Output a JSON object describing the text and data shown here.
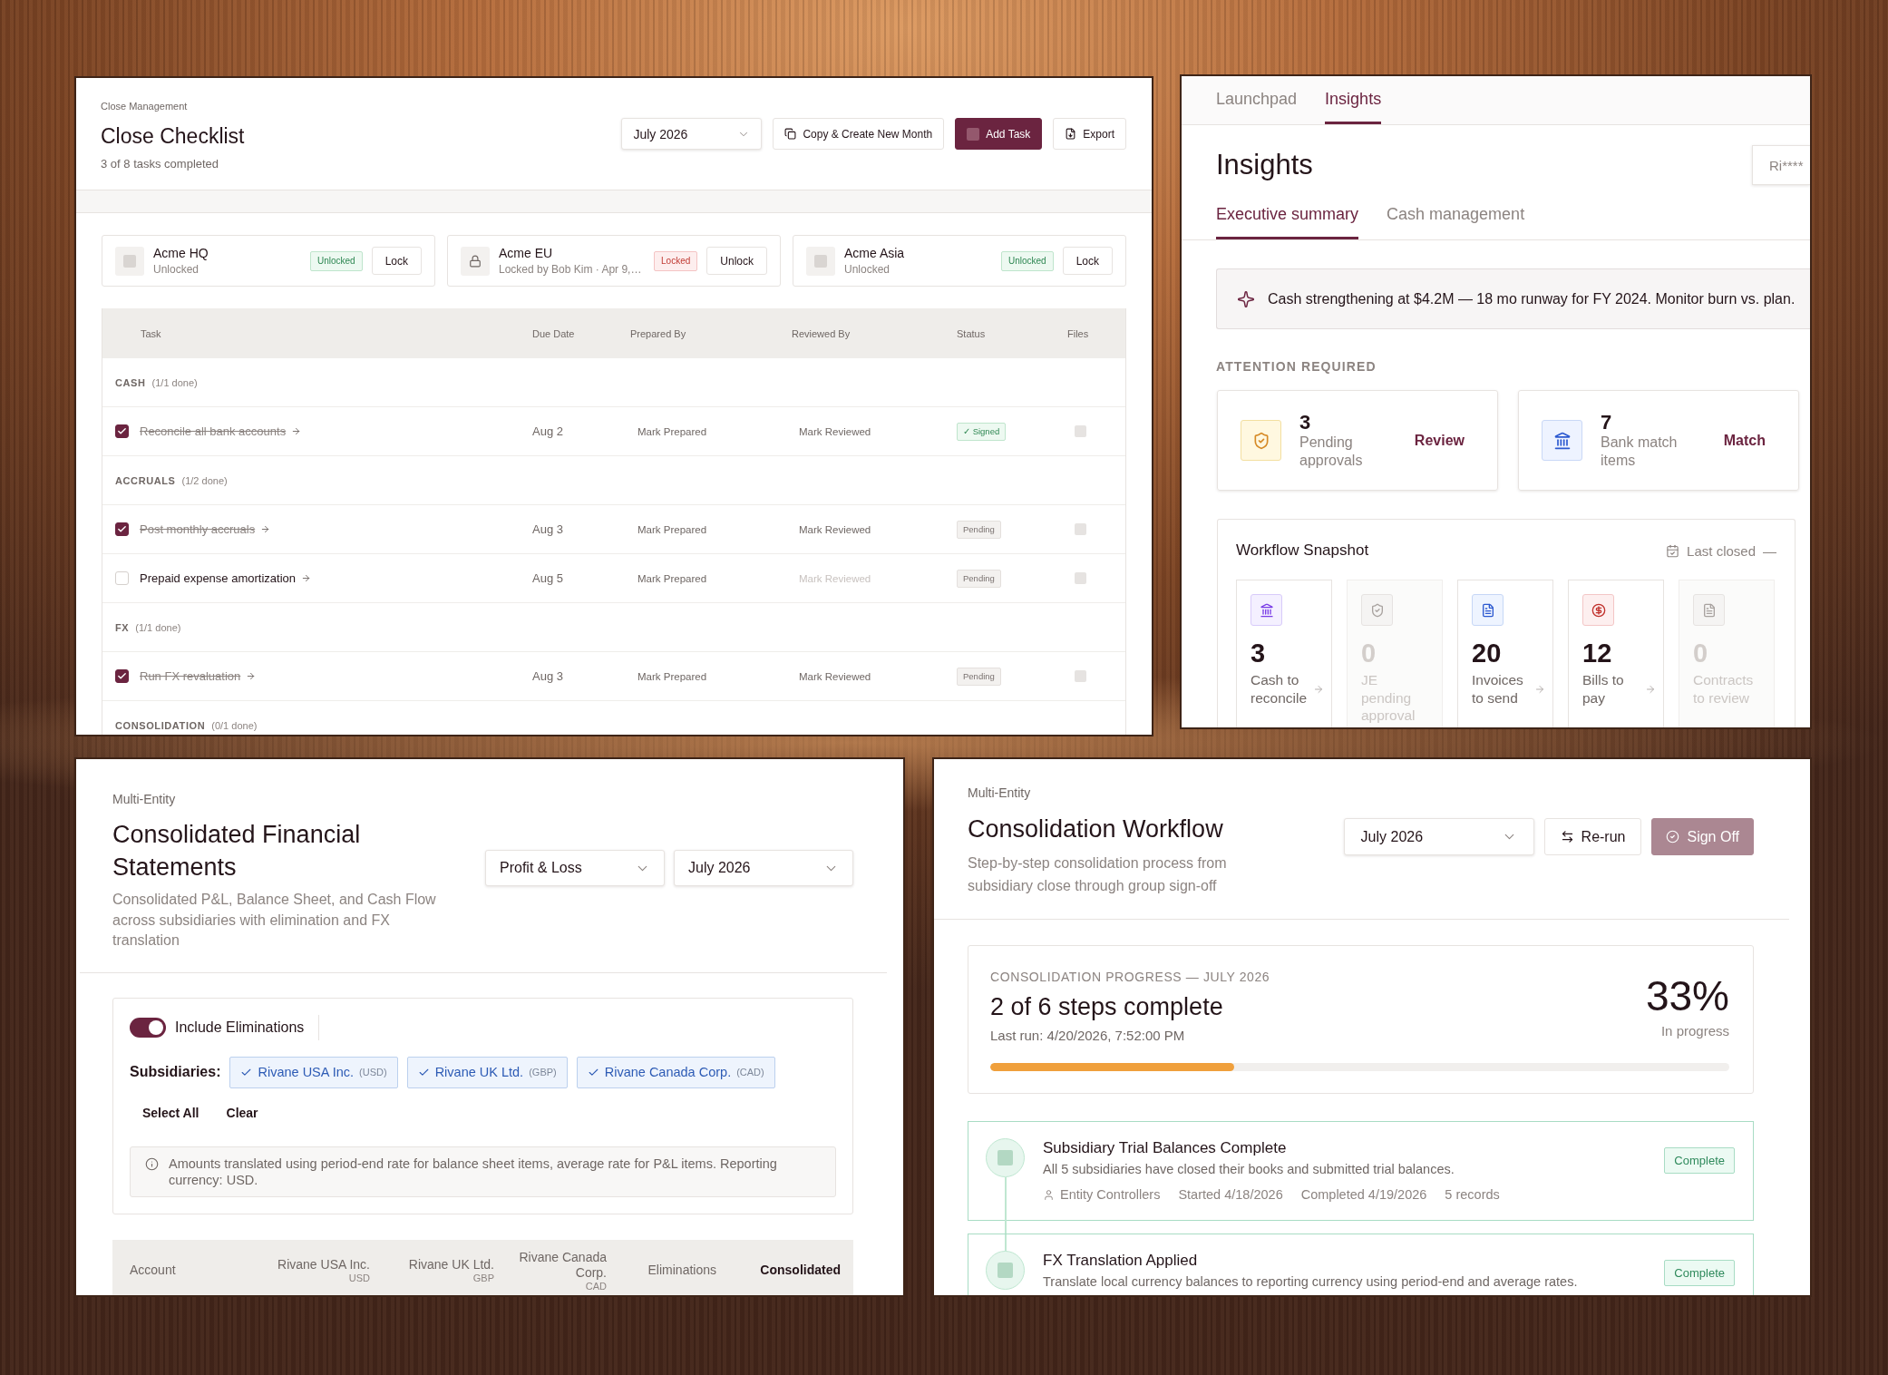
{
  "close_checklist": {
    "breadcrumb": "Close Management",
    "title": "Close Checklist",
    "subtitle": "3 of 8 tasks completed",
    "period": "July 2026",
    "actions": [
      {
        "kind": "copy",
        "label": "Copy & Create New Month"
      },
      {
        "kind": "add",
        "label": "Add Task"
      },
      {
        "kind": "export",
        "label": "Export"
      }
    ],
    "entities": [
      {
        "name": "Acme HQ",
        "detail": "Unlocked",
        "locked": false,
        "badge": "Unlocked",
        "action": "Lock"
      },
      {
        "name": "Acme EU",
        "detail": "Locked by Bob Kim · Apr 9,…",
        "locked": true,
        "badge": "Locked",
        "action": "Unlock"
      },
      {
        "name": "Acme Asia",
        "detail": "Unlocked",
        "locked": false,
        "badge": "Unlocked",
        "action": "Lock"
      }
    ],
    "table": {
      "columns": [
        "Task",
        "Due Date",
        "Prepared By",
        "Reviewed By",
        "Status",
        "Files"
      ],
      "groups": [
        {
          "name": "CASH",
          "count": "(1/1 done)",
          "tasks": [
            {
              "title": "Reconcile all bank accounts",
              "checked": true,
              "due": "Aug 2",
              "prepared_by": "Mark Prepared",
              "reviewed_by": "Mark Reviewed",
              "reviewed": true,
              "status": {
                "kind": "signed",
                "label": "✓ Signed"
              }
            }
          ]
        },
        {
          "name": "ACCRUALS",
          "count": "(1/2 done)",
          "tasks": [
            {
              "title": "Post monthly accruals",
              "checked": true,
              "due": "Aug 3",
              "prepared_by": "Mark Prepared",
              "reviewed_by": "Mark Reviewed",
              "reviewed": true,
              "status": {
                "kind": "pending",
                "label": "Pending"
              }
            },
            {
              "title": "Prepaid expense amortization",
              "checked": false,
              "due": "Aug 5",
              "prepared_by": "Mark Prepared",
              "reviewed_by": "Mark Reviewed",
              "reviewed": false,
              "status": {
                "kind": "pending",
                "label": "Pending"
              }
            }
          ]
        },
        {
          "name": "FX",
          "count": "(1/1 done)",
          "tasks": [
            {
              "title": "Run FX revaluation",
              "checked": true,
              "due": "Aug 3",
              "prepared_by": "Mark Prepared",
              "reviewed_by": "Mark Reviewed",
              "reviewed": true,
              "status": {
                "kind": "pending",
                "label": "Pending"
              }
            }
          ]
        },
        {
          "name": "CONSOLIDATION",
          "count": "(0/1 done)"
        }
      ]
    }
  },
  "insights": {
    "tabs": [
      {
        "label": "Launchpad",
        "selected": false
      },
      {
        "label": "Insights",
        "selected": true
      }
    ],
    "title": "Insights",
    "user": "Ri****",
    "sub_tabs": [
      {
        "label": "Executive summary",
        "selected": true
      },
      {
        "label": "Cash management",
        "selected": false
      }
    ],
    "insight": "Cash strengthening at $4.2M — 18 mo runway for FY 2024. Monitor burn vs. plan.",
    "attention": {
      "heading": "ATTENTION REQUIRED",
      "items": [
        {
          "kind": "approvals",
          "count": "3",
          "label": "Pending approvals",
          "action": "Review"
        },
        {
          "kind": "bank",
          "count": "7",
          "label": "Bank match items",
          "action": "Match"
        }
      ]
    },
    "snapshot": {
      "title": "Workflow Snapshot",
      "last_closed": "Last closed",
      "last_closed_value": "—",
      "tiles": [
        {
          "kind": "bank",
          "count": "3",
          "label": "Cash to reconcile",
          "disabled": false
        },
        {
          "kind": "approval",
          "count": "0",
          "label": "JE pending approval",
          "disabled": true
        },
        {
          "kind": "invoice",
          "count": "20",
          "label": "Invoices to send",
          "disabled": false
        },
        {
          "kind": "bill",
          "count": "12",
          "label": "Bills to pay",
          "disabled": false
        },
        {
          "kind": "contract",
          "count": "0",
          "label": "Contracts to review",
          "disabled": true
        }
      ]
    }
  },
  "financial_statements": {
    "breadcrumb": "Multi-Entity",
    "title": "Consolidated Financial Statements",
    "description": "Consolidated P&L, Balance Sheet, and Cash Flow across subsidiaries with elimination and FX translation",
    "statement": "Profit & Loss",
    "period": "July 2026",
    "eliminations": {
      "label": "Include Eliminations",
      "on": true
    },
    "subsidiaries_label": "Subsidiaries:",
    "subsidiaries": [
      {
        "name": "Rivane USA Inc.",
        "currency": "(USD)",
        "selected": true
      },
      {
        "name": "Rivane UK Ltd.",
        "currency": "(GBP)",
        "selected": true
      },
      {
        "name": "Rivane Canada Corp.",
        "currency": "(CAD)",
        "selected": true
      }
    ],
    "actions": [
      "Select All",
      "Clear"
    ],
    "note": "Amounts translated using period-end rate for balance sheet items, average rate for P&L items. Reporting currency: USD.",
    "columns": [
      {
        "kind": "account",
        "label": "Account"
      },
      {
        "kind": "entity",
        "label": "Rivane USA Inc.",
        "currency": "USD"
      },
      {
        "kind": "entity",
        "label": "Rivane UK Ltd.",
        "currency": "GBP"
      },
      {
        "kind": "entity",
        "label": "Rivane Canada Corp.",
        "currency": "CAD"
      },
      {
        "kind": "elimination",
        "label": "Eliminations"
      },
      {
        "kind": "total",
        "label": "Consolidated"
      }
    ]
  },
  "consolidation_workflow": {
    "breadcrumb": "Multi-Entity",
    "title": "Consolidation Workflow",
    "description": "Step-by-step consolidation process from subsidiary close through group sign-off",
    "period": "July 2026",
    "rerun": "Re-run",
    "sign_off": {
      "label": "Sign Off",
      "disabled": true
    },
    "progress": {
      "heading": "CONSOLIDATION PROGRESS — JULY 2026",
      "summary": "2 of 6 steps complete",
      "last_run": "Last run: 4/20/2026, 7:52:00 PM",
      "percent": "33%",
      "status": "In progress",
      "level": 0.33
    },
    "steps": [
      {
        "title": "Subsidiary Trial Balances Complete",
        "description": "All 5 subsidiaries have closed their books and submitted trial balances.",
        "owner": "Entity Controllers",
        "started": "Started 4/18/2026",
        "completed": "Completed 4/19/2026",
        "records": "5 records",
        "status": "Complete",
        "done": true
      },
      {
        "title": "FX Translation Applied",
        "description": "Translate local currency balances to reporting currency using period-end and average rates.",
        "status": "Complete",
        "done": true
      }
    ]
  }
}
